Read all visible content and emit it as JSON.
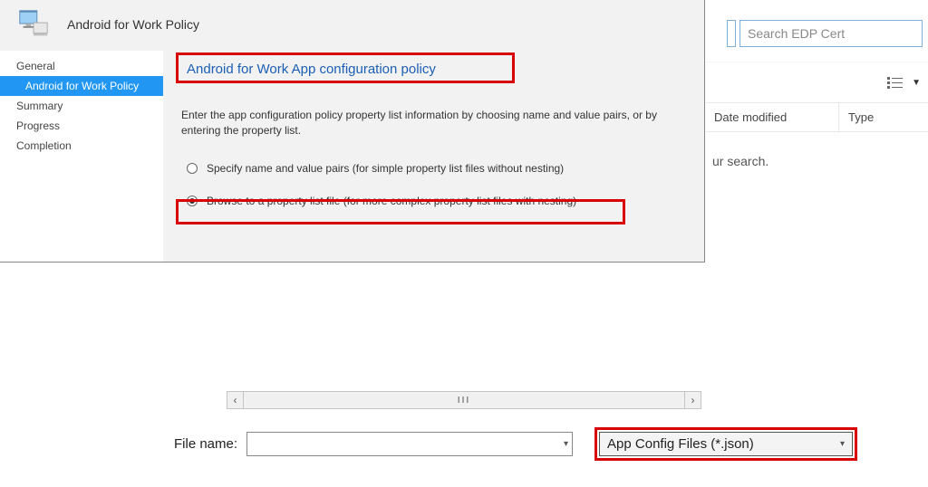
{
  "wizard": {
    "title": "Android for Work Policy",
    "sidebar": [
      {
        "label": "General",
        "selected": false
      },
      {
        "label": "Android for Work Policy",
        "selected": true
      },
      {
        "label": "Summary",
        "selected": false
      },
      {
        "label": "Progress",
        "selected": false
      },
      {
        "label": "Completion",
        "selected": false
      }
    ],
    "content": {
      "heading": "Android for Work App configuration policy",
      "description": "Enter the app configuration policy property list information by choosing name and value pairs, or by entering the property list.",
      "radio1": "Specify name and value pairs (for simple property list files without nesting)",
      "radio2": "Browse to a property list file (for more complex property list files with nesting)"
    }
  },
  "explorer": {
    "search_placeholder": "Search EDP Cert",
    "col_date": "Date modified",
    "col_type": "Type",
    "empty_msg": "ur search."
  },
  "picker": {
    "filename_label": "File name:",
    "filename_value": "",
    "filter_label": "App Config Files (*.json)"
  }
}
